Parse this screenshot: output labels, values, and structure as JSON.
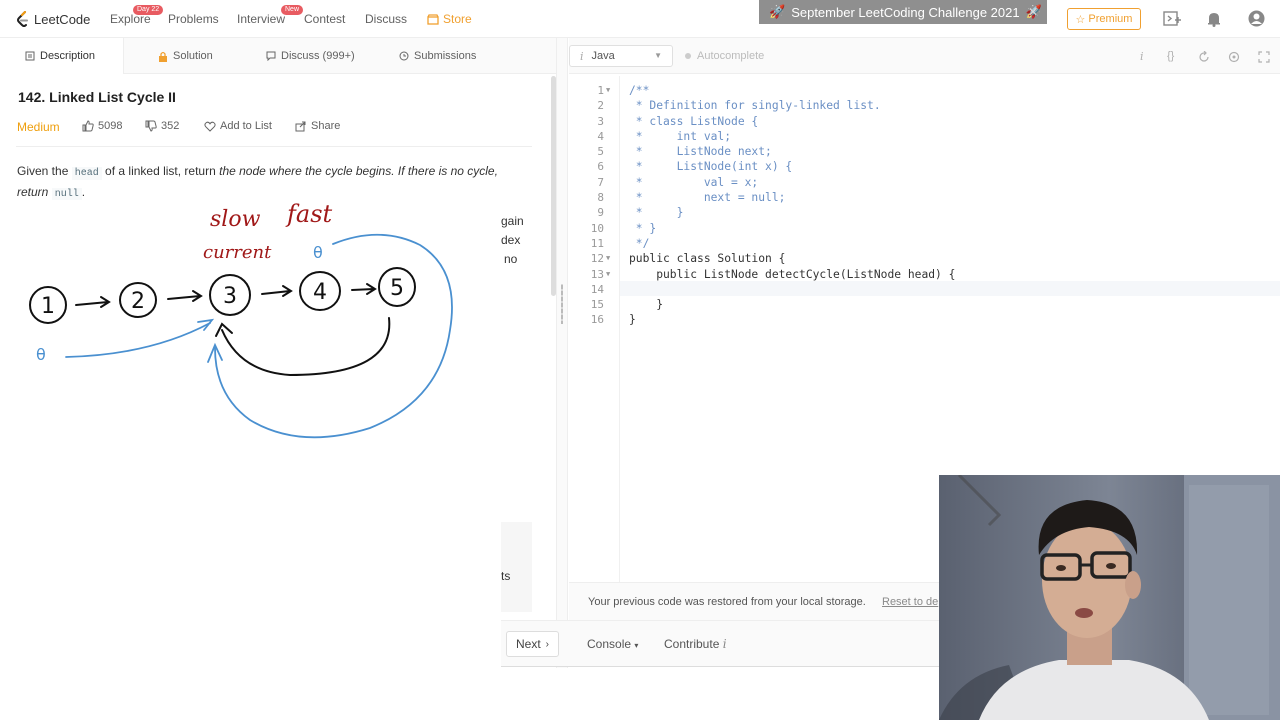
{
  "nav": {
    "logo_text": "LeetCode",
    "items": [
      {
        "label": "Explore",
        "badge": "Day 22"
      },
      {
        "label": "Problems"
      },
      {
        "label": "Interview",
        "badge": "New"
      },
      {
        "label": "Contest"
      },
      {
        "label": "Discuss"
      },
      {
        "label": "Store"
      }
    ],
    "challenge_banner": "September LeetCoding Challenge 2021",
    "premium_label": "Premium"
  },
  "left_tabs": [
    {
      "label": "Description",
      "icon": "description-icon",
      "active": true
    },
    {
      "label": "Solution",
      "icon": "lock-icon"
    },
    {
      "label": "Discuss (999+)",
      "icon": "discuss-icon"
    },
    {
      "label": "Submissions",
      "icon": "history-icon"
    }
  ],
  "problem": {
    "title": "142. Linked List Cycle II",
    "difficulty": "Medium",
    "likes": "5098",
    "dislikes": "352",
    "add_to_list": "Add to List",
    "share": "Share",
    "description_parts": {
      "p1": "Given the ",
      "code1": "head",
      "p2": " of a linked list, return ",
      "em1": "the node where the cycle begins. If there is no cycle, return ",
      "code2": "null",
      "p3": "."
    },
    "partial_text": [
      "gain",
      "dex",
      "no",
      "ts"
    ]
  },
  "whiteboard": {
    "labels": {
      "slow": "slow",
      "current": "current",
      "fast": "fast"
    },
    "nodes": [
      "1",
      "2",
      "3",
      "4",
      "5"
    ],
    "pointer_symbol": "θ"
  },
  "editor": {
    "language": "Java",
    "autocomplete": "Autocomplete",
    "lines": [
      {
        "n": "1",
        "fold": true,
        "text": "/**",
        "type": "comment"
      },
      {
        "n": "2",
        "text": " * Definition for singly-linked list.",
        "type": "comment"
      },
      {
        "n": "3",
        "text": " * class ListNode {",
        "type": "comment"
      },
      {
        "n": "4",
        "text": " *     int val;",
        "type": "comment"
      },
      {
        "n": "5",
        "text": " *     ListNode next;",
        "type": "comment"
      },
      {
        "n": "6",
        "text": " *     ListNode(int x) {",
        "type": "comment"
      },
      {
        "n": "7",
        "text": " *         val = x;",
        "type": "comment"
      },
      {
        "n": "8",
        "text": " *         next = null;",
        "type": "comment"
      },
      {
        "n": "9",
        "text": " *     }",
        "type": "comment"
      },
      {
        "n": "10",
        "text": " * }",
        "type": "comment"
      },
      {
        "n": "11",
        "text": " */",
        "type": "comment"
      },
      {
        "n": "12",
        "fold": true,
        "text": "public class Solution {",
        "type": "code"
      },
      {
        "n": "13",
        "fold": true,
        "text": "    public ListNode detectCycle(ListNode head) {",
        "type": "code"
      },
      {
        "n": "14",
        "text": "",
        "type": "code"
      },
      {
        "n": "15",
        "text": "    }",
        "type": "code"
      },
      {
        "n": "16",
        "text": "}",
        "type": "code"
      }
    ],
    "restore_message": "Your previous code was restored from your local storage.",
    "reset_link": "Reset to de"
  },
  "bottom": {
    "next_label": "Next",
    "console_label": "Console",
    "contribute_label": "Contribute"
  },
  "colors": {
    "accent": "#f0a030",
    "medium": "#ef9f0e",
    "badge": "#e85b61",
    "ink_blue": "#4a90d0",
    "ink_red": "#a01818"
  }
}
